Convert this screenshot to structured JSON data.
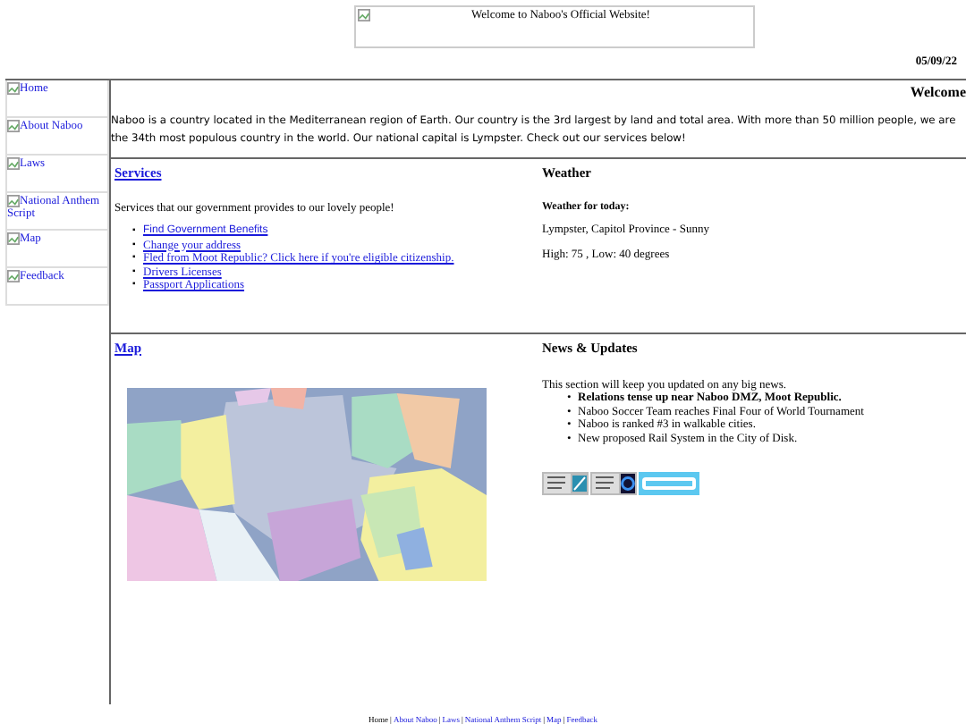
{
  "banner": {
    "alt": "Welcome to Naboo's Official Website!"
  },
  "date": "05/09/22",
  "sidebar": {
    "items": [
      {
        "label": "Home"
      },
      {
        "label": "About Naboo"
      },
      {
        "label": "Laws"
      },
      {
        "label": "National Anthem Script"
      },
      {
        "label": "Map"
      },
      {
        "label": "Feedback"
      }
    ]
  },
  "welcome": {
    "title": "Welcome",
    "text": "Naboo is a country located in the Mediterranean region of Earth. Our country is the 3rd largest by land and total area. With more than 50 million people, we are the 34th most populous country in the world. Our national capital is Lympster. Check out our services below!"
  },
  "services": {
    "title": "Services",
    "intro": "Services that our government provides to our lovely people!",
    "marker": "▪",
    "links": [
      {
        "label": "Find Government Benefits",
        "kind": "sans"
      },
      {
        "label": "Change your address",
        "kind": "serif"
      },
      {
        "label": "Fled from Moot Republic? Click here if you're eligible citizenship.",
        "kind": "serif"
      },
      {
        "label": "Drivers Licenses",
        "kind": "serif"
      },
      {
        "label": "Passport Applications",
        "kind": "serif"
      }
    ]
  },
  "weather": {
    "title": "Weather",
    "subtitle": "Weather for today:",
    "lines": [
      "Lympster, Capitol Province - Sunny",
      "High: 75 , Low: 40 degrees"
    ]
  },
  "map": {
    "title": "Map"
  },
  "news": {
    "title": "News & Updates",
    "intro": "This section will keep you updated on any big news.",
    "marker": "•",
    "items": [
      {
        "text": "Relations tense up near Naboo DMZ, Moot Republic.",
        "bold": true
      },
      {
        "text": "Naboo Soccer Team reaches Final Four of World Tournament",
        "bold": false
      },
      {
        "text": "Naboo is ranked #3 in walkable cities.",
        "bold": false
      },
      {
        "text": "New proposed Rail System in the City of Disk.",
        "bold": false
      }
    ]
  },
  "footer": {
    "separator": "|",
    "links": [
      {
        "label": "Home",
        "kind": "current"
      },
      {
        "label": "About Naboo",
        "kind": "link"
      },
      {
        "label": "Laws",
        "kind": "link"
      },
      {
        "label": "National Anthem Script",
        "kind": "link"
      },
      {
        "label": "Map",
        "kind": "link"
      },
      {
        "label": "Feedback",
        "kind": "link"
      }
    ]
  }
}
